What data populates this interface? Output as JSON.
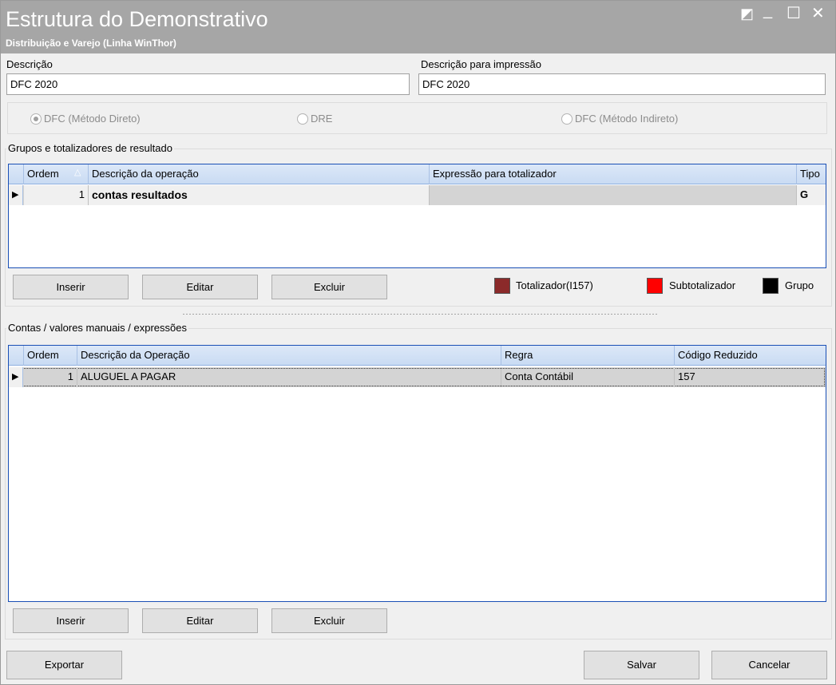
{
  "window": {
    "title": "Estrutura do Demonstrativo",
    "subtitle": "Distribuição e Varejo (Linha WinThor)",
    "controls": {
      "restore": "◩",
      "minimize": "_",
      "maximize": "☐",
      "close": "✕"
    }
  },
  "form": {
    "descricao_label": "Descrição",
    "descricao_value": "DFC 2020",
    "impressao_label": "Descrição para impressão",
    "impressao_value": "DFC 2020"
  },
  "radios": [
    {
      "label": "DFC (Método Direto)",
      "checked": true
    },
    {
      "label": "DRE",
      "checked": false
    },
    {
      "label": "DFC (Método Indireto)",
      "checked": false
    }
  ],
  "grupos": {
    "title": "Grupos e totalizadores de resultado",
    "columns": [
      "Ordem",
      "Descrição da operação",
      "Expressão para totalizador",
      "Tipo"
    ],
    "rows": [
      {
        "ordem": "1",
        "descricao": "contas resultados",
        "expressao": "",
        "tipo": "G"
      }
    ],
    "buttons": {
      "inserir": "Inserir",
      "editar": "Editar",
      "excluir": "Excluir"
    },
    "legend": [
      {
        "label": "Totalizador(I157)",
        "color": "#8b2a2a"
      },
      {
        "label": "Subtotalizador",
        "color": "#ff0000"
      },
      {
        "label": "Grupo",
        "color": "#000000"
      }
    ]
  },
  "contas": {
    "title": "Contas / valores manuais / expressões",
    "columns": [
      "Ordem",
      "Descrição da Operação",
      "Regra",
      "Código Reduzido"
    ],
    "rows": [
      {
        "ordem": "1",
        "descricao": "ALUGUEL A PAGAR",
        "regra": "Conta Contábil",
        "codigo": "157"
      }
    ],
    "buttons": {
      "inserir": "Inserir",
      "editar": "Editar",
      "excluir": "Excluir"
    }
  },
  "footer": {
    "exportar": "Exportar",
    "salvar": "Salvar",
    "cancelar": "Cancelar"
  },
  "colors": {
    "titlebar": "#a6a6a6",
    "grid_border": "#1a4fb5",
    "selected_row": "#d4d4d4"
  }
}
